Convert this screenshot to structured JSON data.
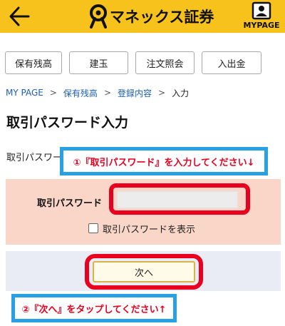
{
  "header": {
    "back_icon": "left-arrow-icon",
    "brand": "マネックス証券",
    "brand_color": "#f6c21b",
    "mypage_label": "MYPAGE",
    "mypage_icon": "person-card-icon"
  },
  "tabs": [
    {
      "label": "保有残高"
    },
    {
      "label": "建玉"
    },
    {
      "label": "注文照会"
    },
    {
      "label": "入出金"
    }
  ],
  "breadcrumb": {
    "items": [
      "MY PAGE",
      "保有残高",
      "登録内容"
    ],
    "separator": ">",
    "current": "入力"
  },
  "page_title": "取引パスワード入力",
  "subheading": "取引パスワード",
  "subheading_tail": "›",
  "form": {
    "password_label": "取引パスワード",
    "password_value": "",
    "show_password_label": "取引パスワードを表示",
    "show_password_checked": false,
    "next_button": "次へ"
  },
  "annotations": {
    "callout_1": "①『取引パスワード』を入力してください↓",
    "callout_2": "②『次へ』をタップしてください↑",
    "callout_border_color": "#27a0e6",
    "callout_text_color": "#e6001e",
    "highlight_color": "#e8001e"
  }
}
